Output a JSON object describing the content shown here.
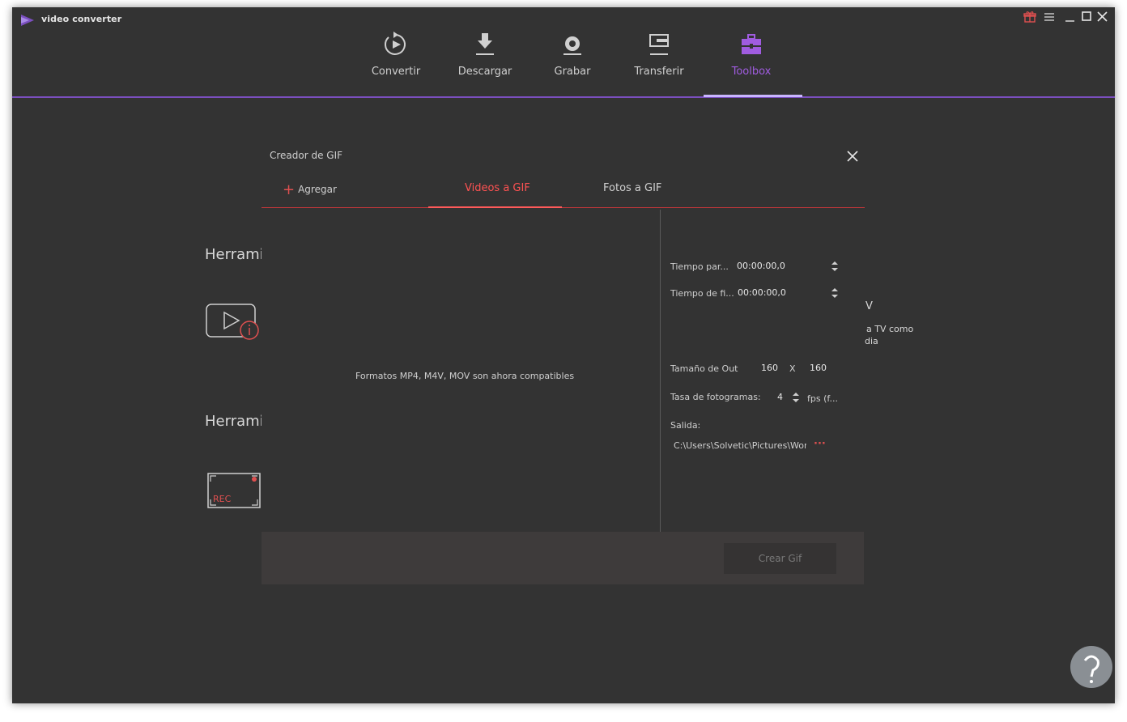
{
  "app": {
    "title": "video converter"
  },
  "nav": {
    "items": [
      {
        "label": "Convertir",
        "icon": "convert-icon"
      },
      {
        "label": "Descargar",
        "icon": "download-icon"
      },
      {
        "label": "Grabar",
        "icon": "record-icon"
      },
      {
        "label": "Transferir",
        "icon": "transfer-icon"
      },
      {
        "label": "Toolbox",
        "icon": "toolbox-icon",
        "active": true
      }
    ]
  },
  "background": {
    "tool_heading_1": "Herrami",
    "tool_heading_2": "Herrami",
    "rec_label": "REC",
    "right_fragment_title": "V",
    "right_fragment_line1": "a TV como",
    "right_fragment_line2": "dia"
  },
  "dialog": {
    "title": "Creador de GIF",
    "add_label": "Agregar",
    "tabs": [
      {
        "label": "Videos a GIF",
        "active": true
      },
      {
        "label": "Fotos a GIF",
        "active": false
      }
    ],
    "compat_text": "Formatos MP4, M4V, MOV son ahora compatibles",
    "start_time_label": "Tiempo par...",
    "start_time_value": "00:00:00,0",
    "end_time_label": "Tiempo de fi...",
    "end_time_value": "00:00:00,0",
    "size_label": "Tamaño de Out",
    "width": "160",
    "size_sep": "X",
    "height": "160",
    "fps_label": "Tasa de fotogramas:",
    "fps_value": "4",
    "fps_unit": "fps (f...",
    "output_label": "Salida:",
    "output_path": "C:\\Users\\Solvetic\\Pictures\\Wonc",
    "browse_label": "···",
    "create_button": "Crear Gif"
  },
  "colors": {
    "accent_purple": "#a05ce0",
    "accent_red": "#ff5252",
    "background": "#333333"
  }
}
